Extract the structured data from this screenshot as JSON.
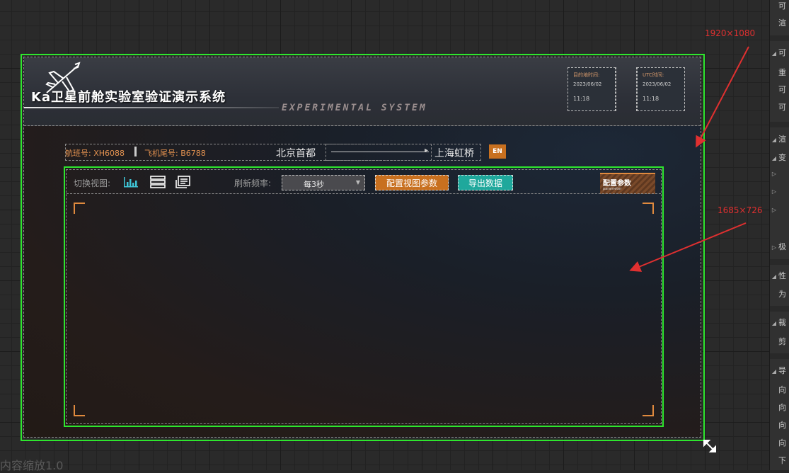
{
  "system": {
    "title": "Ka卫星前舱实验室验证演示系统",
    "subtitle": "EXPERIMENTAL SYSTEM"
  },
  "times": {
    "local": {
      "label": "目的地时间:",
      "date": "2023/06/02",
      "time": "11:18"
    },
    "utc": {
      "label": "UTC时间:",
      "date": "2023/06/02",
      "time": "11:18"
    }
  },
  "flight": {
    "flight_no": "航班号: XH6088",
    "tail_no": "飞机尾号: B6788",
    "from": "北京首都",
    "to": "上海虹桥",
    "lang_button": "EN"
  },
  "toolbar": {
    "view_label": "切换视图:",
    "refresh_label": "刷新频率:",
    "refresh_value": "每3秒",
    "config_button": "配置视图参数",
    "export_button": "导出数据",
    "badge_title": "配置参数",
    "badge_sub": "parameter"
  },
  "annotations": {
    "artboard_size": "1920×1080",
    "panel_size": "1685×726"
  },
  "editor": {
    "zoom_text": "内容缩放1.0",
    "panel_items": [
      "可",
      "渲",
      "可",
      "重",
      "可",
      "可",
      "渲",
      "变",
      "极",
      "性",
      "为",
      "裁",
      "剪",
      "导",
      "向",
      "向",
      "向",
      "向",
      "下"
    ]
  },
  "colors": {
    "accent_orange": "#c8701f",
    "accent_teal": "#1fa89c",
    "outline_green": "#2ee62e",
    "annotation_red": "#e03030"
  }
}
